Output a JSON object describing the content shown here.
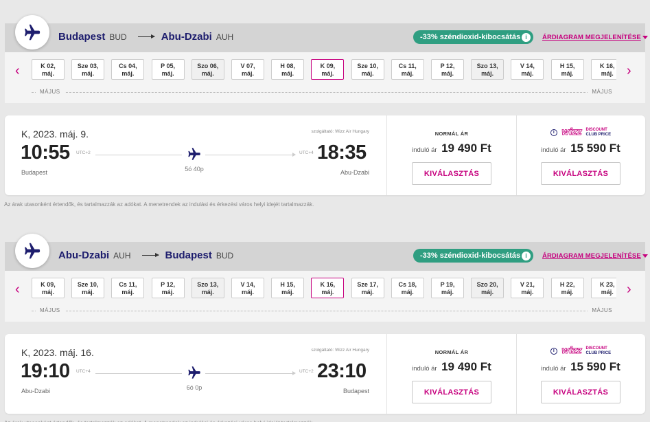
{
  "legs": [
    {
      "route": {
        "from_city": "Budapest",
        "from_code": "BUD",
        "to_city": "Abu-Dzabi",
        "to_code": "AUH"
      },
      "co2_label": "-33% széndioxid-kibocsátás",
      "chart_link": "ÁRDIAGRAM MEGJELENÍTÉSE",
      "month_label": "MÁJUS",
      "dates": [
        {
          "day": "K 02,",
          "mon": "máj.",
          "weekend": false,
          "selected": false
        },
        {
          "day": "Sze 03,",
          "mon": "máj.",
          "weekend": false,
          "selected": false
        },
        {
          "day": "Cs 04,",
          "mon": "máj.",
          "weekend": false,
          "selected": false
        },
        {
          "day": "P 05,",
          "mon": "máj.",
          "weekend": false,
          "selected": false
        },
        {
          "day": "Szo 06,",
          "mon": "máj.",
          "weekend": true,
          "selected": false
        },
        {
          "day": "V 07,",
          "mon": "máj.",
          "weekend": false,
          "selected": false
        },
        {
          "day": "H 08,",
          "mon": "máj.",
          "weekend": false,
          "selected": false
        },
        {
          "day": "K 09,",
          "mon": "máj.",
          "weekend": false,
          "selected": true
        },
        {
          "day": "Sze 10,",
          "mon": "máj.",
          "weekend": false,
          "selected": false
        },
        {
          "day": "Cs 11,",
          "mon": "máj.",
          "weekend": false,
          "selected": false
        },
        {
          "day": "P 12,",
          "mon": "máj.",
          "weekend": false,
          "selected": false
        },
        {
          "day": "Szo 13,",
          "mon": "máj.",
          "weekend": true,
          "selected": false
        },
        {
          "day": "V 14,",
          "mon": "máj.",
          "weekend": false,
          "selected": false
        },
        {
          "day": "H 15,",
          "mon": "máj.",
          "weekend": false,
          "selected": false
        },
        {
          "day": "K 16,",
          "mon": "máj.",
          "weekend": false,
          "selected": false
        }
      ],
      "flight": {
        "date": "K, 2023. máj. 9.",
        "operator": "szolgáltató: Wizz Air Hungary",
        "dep_time": "10:55",
        "dep_tz": "UTC+2",
        "dep_city": "Budapest",
        "arr_time": "18:35",
        "arr_tz": "UTC+4",
        "arr_city": "Abu-Dzabi",
        "duration": "5ó 40p"
      },
      "fares": {
        "normal_label": "NORMÁL ÁR",
        "from_label": "induló ár",
        "normal_price": "19 490 Ft",
        "dc_brand": "wizz",
        "dc_line1": "DISCOUNT",
        "dc_line2": "CLUB PRICE",
        "dc_price": "15 590 Ft",
        "select_label": "KIVÁLASZTÁS"
      },
      "note": "Az árak utasonként értendők, és tartalmazzák az adókat. A menetrendek az indulási és érkezési város helyi idejét tartalmazzák."
    },
    {
      "route": {
        "from_city": "Abu-Dzabi",
        "from_code": "AUH",
        "to_city": "Budapest",
        "to_code": "BUD"
      },
      "co2_label": "-33% széndioxid-kibocsátás",
      "chart_link": "ÁRDIAGRAM MEGJELENÍTÉSE",
      "month_label": "MÁJUS",
      "dates": [
        {
          "day": "K 09,",
          "mon": "máj.",
          "weekend": false,
          "selected": false
        },
        {
          "day": "Sze 10,",
          "mon": "máj.",
          "weekend": false,
          "selected": false
        },
        {
          "day": "Cs 11,",
          "mon": "máj.",
          "weekend": false,
          "selected": false
        },
        {
          "day": "P 12,",
          "mon": "máj.",
          "weekend": false,
          "selected": false
        },
        {
          "day": "Szo 13,",
          "mon": "máj.",
          "weekend": true,
          "selected": false
        },
        {
          "day": "V 14,",
          "mon": "máj.",
          "weekend": false,
          "selected": false
        },
        {
          "day": "H 15,",
          "mon": "máj.",
          "weekend": false,
          "selected": false
        },
        {
          "day": "K 16,",
          "mon": "máj.",
          "weekend": false,
          "selected": true
        },
        {
          "day": "Sze 17,",
          "mon": "máj.",
          "weekend": false,
          "selected": false
        },
        {
          "day": "Cs 18,",
          "mon": "máj.",
          "weekend": false,
          "selected": false
        },
        {
          "day": "P 19,",
          "mon": "máj.",
          "weekend": false,
          "selected": false
        },
        {
          "day": "Szo 20,",
          "mon": "máj.",
          "weekend": true,
          "selected": false
        },
        {
          "day": "V 21,",
          "mon": "máj.",
          "weekend": false,
          "selected": false
        },
        {
          "day": "H 22,",
          "mon": "máj.",
          "weekend": false,
          "selected": false
        },
        {
          "day": "K 23,",
          "mon": "máj.",
          "weekend": false,
          "selected": false
        }
      ],
      "flight": {
        "date": "K, 2023. máj. 16.",
        "operator": "szolgáltató: Wizz Air Hungary",
        "dep_time": "19:10",
        "dep_tz": "UTC+4",
        "dep_city": "Abu-Dzabi",
        "arr_time": "23:10",
        "arr_tz": "UTC+2",
        "arr_city": "Budapest",
        "duration": "6ó 0p"
      },
      "fares": {
        "normal_label": "NORMÁL ÁR",
        "from_label": "induló ár",
        "normal_price": "19 490 Ft",
        "dc_brand": "wizz",
        "dc_line1": "DISCOUNT",
        "dc_line2": "CLUB PRICE",
        "dc_price": "15 590 Ft",
        "select_label": "KIVÁLASZTÁS"
      },
      "note": "Az árak utasonként értendők, és tartalmazzák az adókat. A menetrendek az indulási és érkezési város helyi idejét tartalmazzák."
    }
  ],
  "colors": {
    "accent": "#c6007e",
    "navy": "#1e1e6e",
    "co2_green": "#2f9e81"
  },
  "icons": {
    "plane": "airplane-icon",
    "prev": "chevron-left-icon",
    "next": "chevron-right-icon",
    "info": "info-icon"
  }
}
